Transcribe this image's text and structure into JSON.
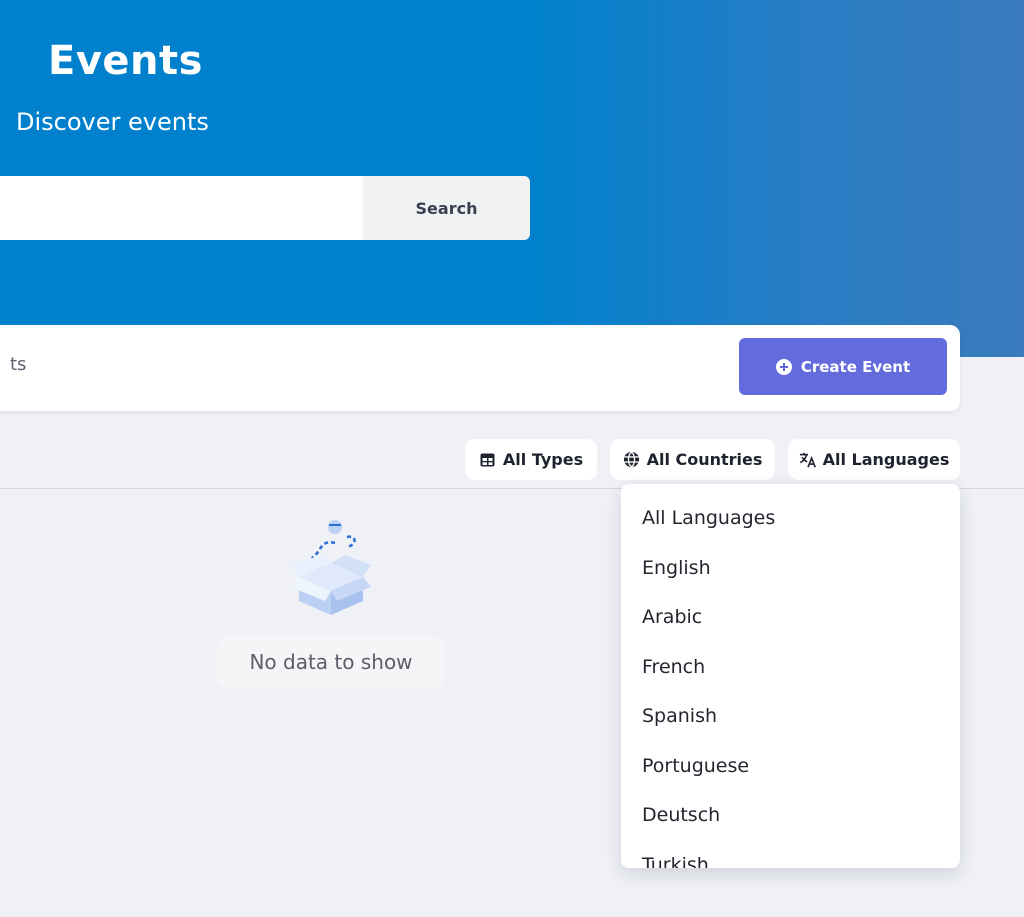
{
  "header": {
    "title": "Events",
    "subtitle": "Discover events"
  },
  "search": {
    "value": "",
    "button_label": "Search"
  },
  "toolbar": {
    "partial_tab_label": "ts",
    "create_button_label": "Create Event",
    "create_button_icon": "plus-circle-icon",
    "create_button_color": "#646cdd"
  },
  "filters": {
    "types_label": "All Types",
    "types_icon": "table-icon",
    "countries_label": "All Countries",
    "countries_icon": "globe-icon",
    "languages_label": "All Languages",
    "languages_icon": "translate-icon"
  },
  "empty_state": {
    "icon": "empty-box-icon",
    "message": "No data to show"
  },
  "languages_dropdown": {
    "options": [
      "All Languages",
      "English",
      "Arabic",
      "French",
      "Spanish",
      "Portuguese",
      "Deutsch",
      "Turkish"
    ]
  },
  "colors": {
    "hero_blue": "#0181cd",
    "accent_purple": "#646cdd",
    "page_background": "#eff1f6"
  }
}
